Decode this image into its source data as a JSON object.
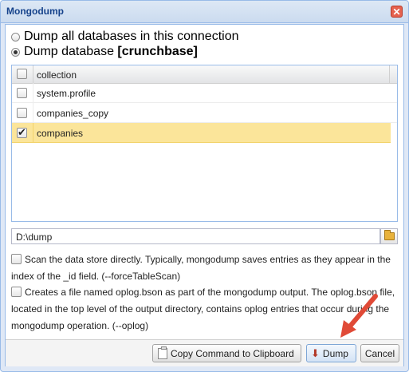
{
  "window": {
    "title": "Mongodump",
    "close_glyph": "✕"
  },
  "dump_options": {
    "all_label": "Dump all databases in this connection",
    "db_label_prefix": "Dump database ",
    "db_name": "[crunchbase]",
    "selected": "database"
  },
  "grid": {
    "column_header": "collection",
    "rows": [
      {
        "name": "system.profile",
        "checked": false
      },
      {
        "name": "companies_copy",
        "checked": false
      },
      {
        "name": "companies",
        "checked": true
      }
    ]
  },
  "output": {
    "path": "D:\\dump",
    "browse_icon": "folder-icon"
  },
  "options": {
    "force_table_scan": "Scan the data store directly. Typically, mongodump saves entries as they appear in the index of the _id field. (--forceTableScan)",
    "oplog": "Creates a file named oplog.bson as part of the mongodump output. The oplog.bson file, located in the top level of the output directory, contains oplog entries that occur during the mongodump operation. (--oplog)"
  },
  "buttons": {
    "copy": "Copy Command to Clipboard",
    "dump": "Dump",
    "cancel": "Cancel"
  },
  "colors": {
    "title_text": "#15428b",
    "selected_row": "#fbe59a",
    "annotation_arrow": "#e04a37"
  }
}
